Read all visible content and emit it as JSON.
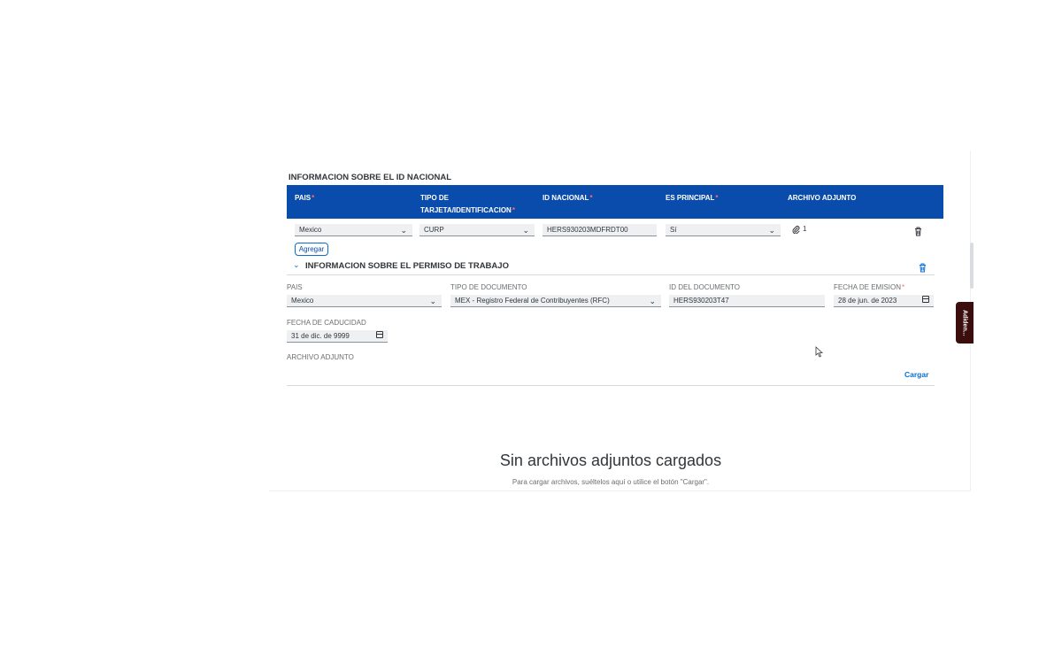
{
  "id_section": {
    "title": "INFORMACION SOBRE EL ID NACIONAL",
    "headers": {
      "pais": "PAIS",
      "tipo_l1": "TIPO DE",
      "tipo_l2": "TARJETA/IDENTIFICACION",
      "id": "ID NACIONAL",
      "principal": "ES PRINCIPAL",
      "adjunto": "ARCHIVO ADJUNTO"
    },
    "row": {
      "pais": "Mexico",
      "tipo": "CURP",
      "id": "HERS930203MDFRDT00",
      "principal": "Sí",
      "adjunto_count": "1"
    },
    "add_label": "Agregar"
  },
  "permit_section": {
    "title": "INFORMACION SOBRE EL PERMISO DE TRABAJO",
    "pais_label": "PAIS",
    "pais_value": "Mexico",
    "tipo_label": "TIPO DE DOCUMENTO",
    "tipo_value": "MEX - Registro Federal de Contribuyentes (RFC)",
    "id_label": "ID DEL DOCUMENTO",
    "id_value": "HERS930203T47",
    "emision_label": "FECHA DE EMISION",
    "emision_value": "28 de jun. de 2023",
    "caducidad_label": "FECHA DE CADUCIDAD",
    "caducidad_value": "31 de dic. de 9999",
    "adjunto_label": "ARCHIVO ADJUNTO",
    "upload_label": "Cargar"
  },
  "empty_state": {
    "title": "Sin archivos adjuntos cargados",
    "subtitle": "Para cargar archivos, suéltelos aquí o utilice el botón \"Cargar\"."
  },
  "side_tab": "Adiden...",
  "colors": {
    "header_blue": "#0a4cab",
    "link_blue": "#0a6ed1",
    "required": "#ff6c6c"
  }
}
